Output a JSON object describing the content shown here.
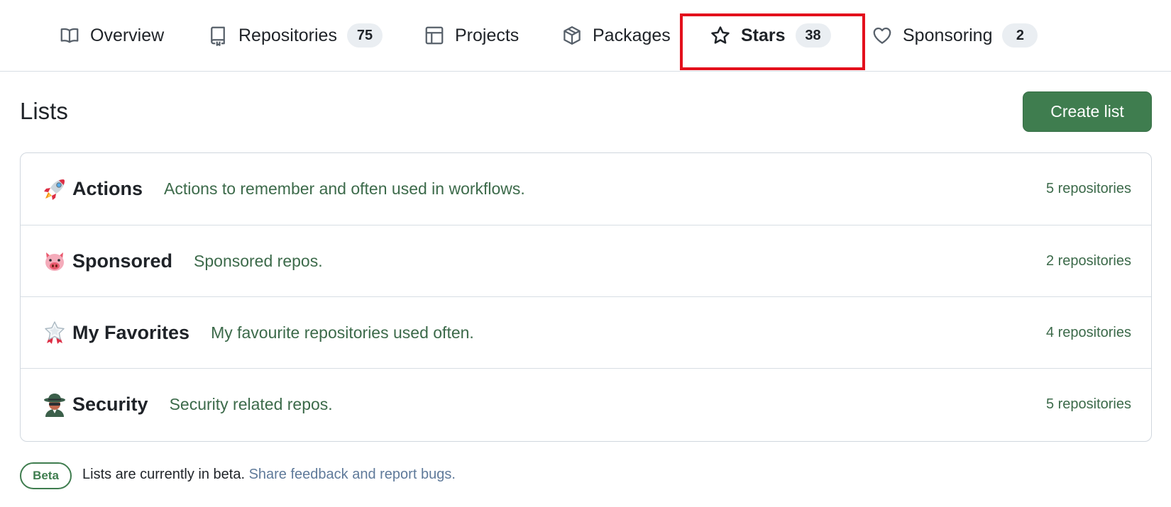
{
  "tabs": [
    {
      "label": "Overview",
      "icon": "book-icon",
      "counter": null
    },
    {
      "label": "Repositories",
      "icon": "repo-icon",
      "counter": "75"
    },
    {
      "label": "Projects",
      "icon": "table-icon",
      "counter": null
    },
    {
      "label": "Packages",
      "icon": "package-icon",
      "counter": null
    },
    {
      "label": "Stars",
      "icon": "star-icon",
      "counter": "38",
      "active": true
    },
    {
      "label": "Sponsoring",
      "icon": "heart-icon",
      "counter": "2"
    }
  ],
  "lists": {
    "title": "Lists",
    "create_label": "Create list",
    "items": [
      {
        "emoji": "rocket-emoji",
        "name": "Actions",
        "description": "Actions to remember and often used in workflows.",
        "count": "5 repositories"
      },
      {
        "emoji": "pig-emoji",
        "name": "Sponsored",
        "description": "Sponsored repos.",
        "count": "2 repositories"
      },
      {
        "emoji": "star-badge-emoji",
        "name": "My Favorites",
        "description": "My favourite repositories used often.",
        "count": "4 repositories"
      },
      {
        "emoji": "spy-emoji",
        "name": "Security",
        "description": "Security related repos.",
        "count": "5 repositories"
      }
    ]
  },
  "beta": {
    "badge": "Beta",
    "text": "Lists are currently in beta.",
    "link": "Share feedback and report bugs."
  },
  "colors": {
    "accent_green": "#3f7d4f",
    "highlight_red": "#e3101c",
    "description_green": "#3c6a4a",
    "link_blue": "#5f7a9a"
  }
}
